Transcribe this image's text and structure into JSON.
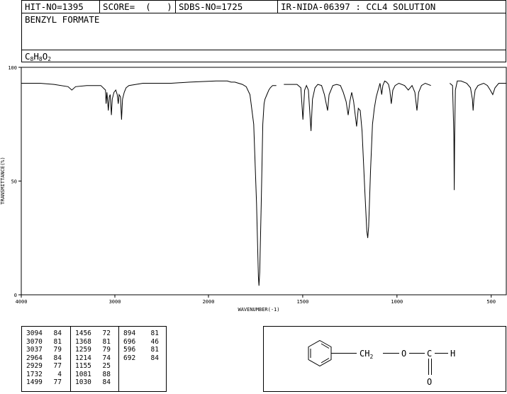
{
  "header": {
    "hit_no": "HIT-NO=1395",
    "score": "SCORE=  (   )",
    "sdbs_no": "SDBS-NO=1725",
    "ir_no": "IR-NIDA-06397 : CCL4 SOLUTION",
    "compound_name": "BENZYL FORMATE",
    "formula": {
      "c": "C",
      "c_n": "8",
      "h": "H",
      "h_n": "8",
      "o": "O",
      "o_n": "2"
    }
  },
  "chart_data": {
    "type": "line",
    "xlabel": "WAVENUMBER(-1)",
    "ylabel": "TRANSMITTANCE(%)",
    "xlim": [
      4000,
      420
    ],
    "ylim": [
      0,
      100
    ],
    "x_ticks": [
      4000,
      3000,
      2000,
      1500,
      1000,
      500
    ],
    "y_ticks": [
      0,
      50,
      100
    ],
    "grid": false,
    "segments": [
      [
        [
          4000,
          93
        ],
        [
          3800,
          93
        ],
        [
          3650,
          92.5
        ],
        [
          3500,
          91.5
        ],
        [
          3460,
          90
        ],
        [
          3420,
          91.5
        ],
        [
          3300,
          92
        ],
        [
          3150,
          92
        ],
        [
          3100,
          90
        ],
        [
          3094,
          84
        ],
        [
          3085,
          89
        ],
        [
          3070,
          81
        ],
        [
          3060,
          87
        ],
        [
          3050,
          88
        ],
        [
          3037,
          79
        ],
        [
          3028,
          86
        ],
        [
          3010,
          89
        ],
        [
          2990,
          90
        ],
        [
          2975,
          88
        ],
        [
          2964,
          84
        ],
        [
          2955,
          88
        ],
        [
          2940,
          87
        ],
        [
          2929,
          77
        ],
        [
          2918,
          86
        ],
        [
          2900,
          89
        ],
        [
          2880,
          91
        ],
        [
          2850,
          92
        ],
        [
          2700,
          93
        ],
        [
          2400,
          93
        ],
        [
          2200,
          93.5
        ],
        [
          1960,
          94
        ],
        [
          1900,
          94
        ],
        [
          1880,
          93.5
        ],
        [
          1860,
          93.5
        ],
        [
          1820,
          92.5
        ],
        [
          1800,
          91.5
        ],
        [
          1780,
          88
        ],
        [
          1760,
          75
        ],
        [
          1745,
          40
        ],
        [
          1735,
          8
        ],
        [
          1732,
          4
        ],
        [
          1728,
          10
        ],
        [
          1720,
          40
        ],
        [
          1712,
          75
        ],
        [
          1705,
          84
        ],
        [
          1700,
          86
        ],
        [
          1690,
          88
        ],
        [
          1680,
          90
        ],
        [
          1672,
          91
        ],
        [
          1660,
          92
        ],
        [
          1640,
          92
        ]
      ],
      [
        [
          1600,
          92.5
        ],
        [
          1530,
          92.5
        ],
        [
          1510,
          91
        ],
        [
          1499,
          77
        ],
        [
          1490,
          90
        ],
        [
          1480,
          92
        ],
        [
          1470,
          90
        ],
        [
          1456,
          72
        ],
        [
          1448,
          86
        ],
        [
          1435,
          91
        ],
        [
          1420,
          92.5
        ],
        [
          1400,
          92
        ],
        [
          1385,
          88
        ],
        [
          1368,
          81
        ],
        [
          1360,
          88
        ],
        [
          1340,
          92
        ],
        [
          1320,
          92.5
        ],
        [
          1300,
          92
        ],
        [
          1285,
          89
        ],
        [
          1270,
          85
        ],
        [
          1259,
          79
        ],
        [
          1250,
          85
        ],
        [
          1240,
          89
        ],
        [
          1230,
          85
        ],
        [
          1214,
          74
        ],
        [
          1205,
          82
        ],
        [
          1195,
          81
        ],
        [
          1185,
          72
        ],
        [
          1170,
          45
        ],
        [
          1160,
          28
        ],
        [
          1155,
          25
        ],
        [
          1150,
          30
        ],
        [
          1140,
          55
        ],
        [
          1130,
          75
        ],
        [
          1120,
          82
        ],
        [
          1110,
          87
        ],
        [
          1100,
          90
        ],
        [
          1090,
          93
        ],
        [
          1081,
          88
        ],
        [
          1075,
          92
        ],
        [
          1065,
          94
        ],
        [
          1055,
          93.5
        ],
        [
          1045,
          92.5
        ],
        [
          1038,
          90
        ],
        [
          1030,
          84
        ],
        [
          1022,
          90
        ],
        [
          1010,
          92
        ],
        [
          990,
          93
        ],
        [
          960,
          92
        ],
        [
          940,
          90
        ],
        [
          920,
          92
        ],
        [
          905,
          89
        ],
        [
          894,
          81
        ],
        [
          885,
          89
        ],
        [
          870,
          92
        ],
        [
          850,
          93
        ],
        [
          820,
          92
        ]
      ],
      [
        [
          720,
          93
        ],
        [
          705,
          92
        ],
        [
          698,
          70
        ],
        [
          696,
          46
        ],
        [
          694,
          70
        ],
        [
          690,
          90
        ],
        [
          680,
          94
        ],
        [
          660,
          94
        ],
        [
          630,
          93
        ],
        [
          610,
          91
        ],
        [
          600,
          86
        ],
        [
          596,
          81
        ],
        [
          592,
          86
        ],
        [
          585,
          90
        ],
        [
          570,
          92
        ],
        [
          540,
          93
        ],
        [
          520,
          92
        ],
        [
          505,
          90
        ],
        [
          492,
          88
        ],
        [
          480,
          91
        ],
        [
          460,
          93
        ],
        [
          440,
          93
        ],
        [
          420,
          93
        ]
      ]
    ]
  },
  "peak_table": {
    "columns": [
      [
        [
          "3094",
          "84"
        ],
        [
          "3070",
          "81"
        ],
        [
          "3037",
          "79"
        ],
        [
          "2964",
          "84"
        ],
        [
          "2929",
          "77"
        ],
        [
          "1732",
          "4"
        ],
        [
          "1499",
          "77"
        ]
      ],
      [
        [
          "1456",
          "72"
        ],
        [
          "1368",
          "81"
        ],
        [
          "1259",
          "79"
        ],
        [
          "1214",
          "74"
        ],
        [
          "1155",
          "25"
        ],
        [
          "1081",
          "88"
        ],
        [
          "1030",
          "84"
        ]
      ],
      [
        [
          "894",
          "81"
        ],
        [
          "696",
          "46"
        ],
        [
          "596",
          "81"
        ],
        [
          "692",
          "84"
        ]
      ]
    ]
  },
  "structure": {
    "ch2_label": "CH",
    "ch2_sub": "2",
    "o_label": "O",
    "c_label": "C",
    "h_label": "H",
    "carbonyl_o_label": "O"
  }
}
